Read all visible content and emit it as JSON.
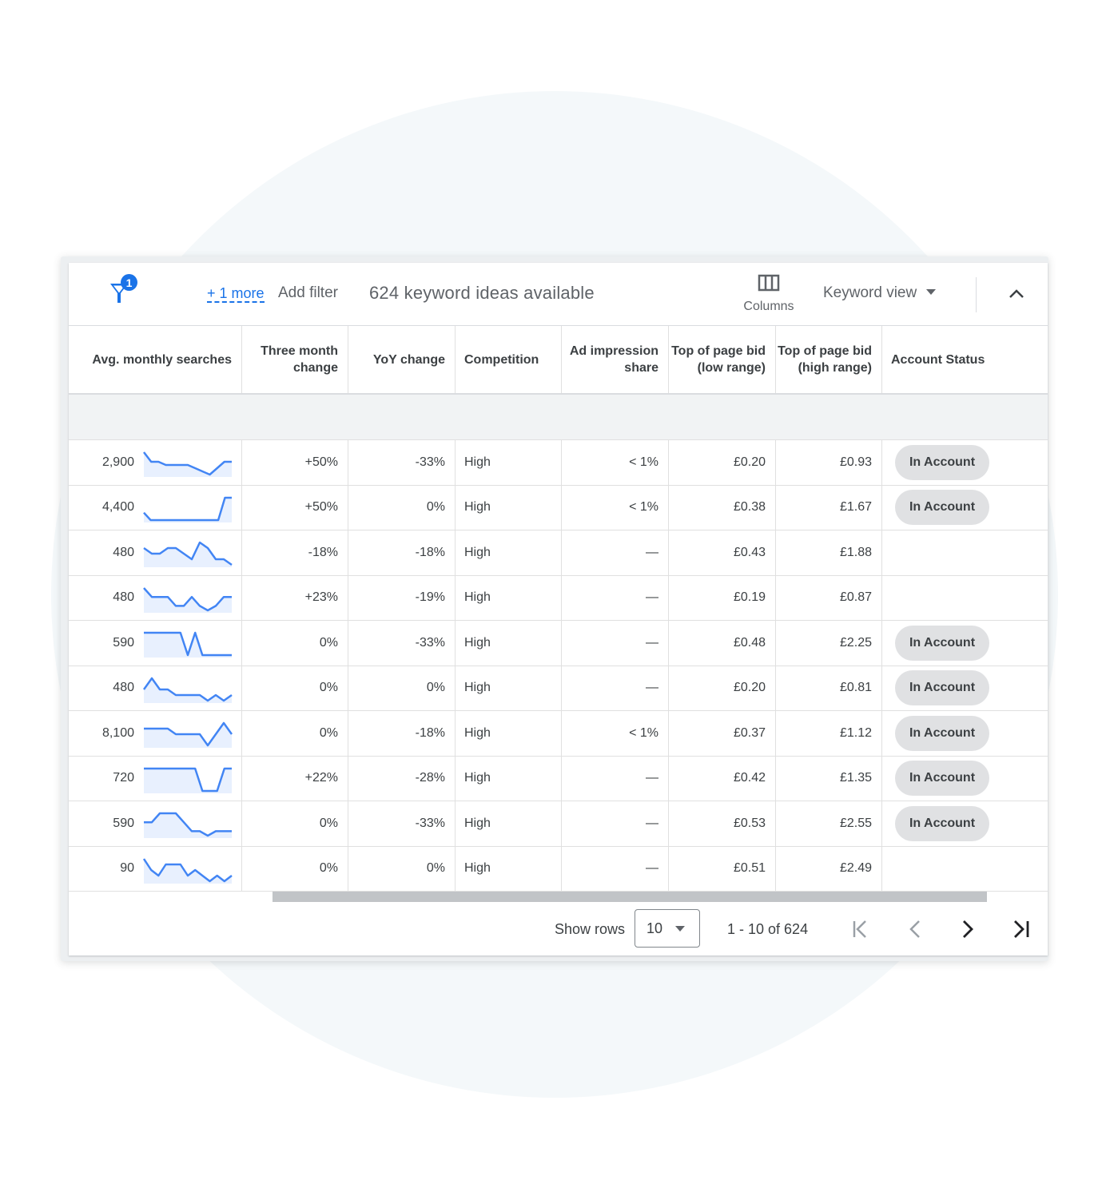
{
  "toolbar": {
    "filter_count": "1",
    "more_link": "+ 1 more",
    "add_filter": "Add filter",
    "ideas_count": "624 keyword ideas available",
    "columns_label": "Columns",
    "keyword_view": "Keyword view"
  },
  "table": {
    "headers": [
      "Avg. monthly searches",
      "Three month change",
      "YoY change",
      "Competition",
      "Ad impression share",
      "Top of page bid (low range)",
      "Top of page bid (high range)",
      "Account Status"
    ],
    "rows": [
      {
        "searches": "2,900",
        "three_month": "+50%",
        "yoy": "-33%",
        "competition": "High",
        "impression": "< 1%",
        "bid_low": "£0.20",
        "bid_high": "£0.93",
        "status": "In Account",
        "trend": [
          8,
          5,
          5,
          4,
          4,
          4,
          4,
          3,
          2,
          1,
          3,
          5,
          5
        ]
      },
      {
        "searches": "4,400",
        "three_month": "+50%",
        "yoy": "0%",
        "competition": "High",
        "impression": "< 1%",
        "bid_low": "£0.38",
        "bid_high": "£1.67",
        "status": "In Account",
        "trend": [
          2,
          1,
          1,
          1,
          1,
          1,
          1,
          1,
          1,
          1,
          1,
          1,
          4,
          4
        ]
      },
      {
        "searches": "480",
        "three_month": "-18%",
        "yoy": "-18%",
        "competition": "High",
        "impression": "—",
        "bid_low": "£0.43",
        "bid_high": "£1.88",
        "status": "",
        "trend": [
          4,
          3,
          3,
          4,
          4,
          3,
          2,
          5,
          4,
          2,
          2,
          1
        ]
      },
      {
        "searches": "480",
        "three_month": "+23%",
        "yoy": "-19%",
        "competition": "High",
        "impression": "—",
        "bid_low": "£0.19",
        "bid_high": "£0.87",
        "status": "",
        "trend": [
          6,
          4,
          4,
          4,
          2,
          2,
          4,
          2,
          1,
          2,
          4,
          4
        ]
      },
      {
        "searches": "590",
        "three_month": "0%",
        "yoy": "-33%",
        "competition": "High",
        "impression": "—",
        "bid_low": "£0.48",
        "bid_high": "£2.25",
        "status": "In Account",
        "trend": [
          5,
          5,
          5,
          5,
          5,
          5,
          1,
          5,
          1,
          1,
          1,
          1,
          1
        ]
      },
      {
        "searches": "480",
        "three_month": "0%",
        "yoy": "0%",
        "competition": "High",
        "impression": "—",
        "bid_low": "£0.20",
        "bid_high": "£0.81",
        "status": "In Account",
        "trend": [
          4,
          6,
          4,
          4,
          3,
          3,
          3,
          3,
          2,
          3,
          2,
          3
        ]
      },
      {
        "searches": "8,100",
        "three_month": "0%",
        "yoy": "-18%",
        "competition": "High",
        "impression": "< 1%",
        "bid_low": "£0.37",
        "bid_high": "£1.12",
        "status": "In Account",
        "trend": [
          5,
          5,
          5,
          5,
          4,
          4,
          4,
          4,
          2,
          4,
          6,
          4
        ]
      },
      {
        "searches": "720",
        "three_month": "+22%",
        "yoy": "-28%",
        "competition": "High",
        "impression": "—",
        "bid_low": "£0.42",
        "bid_high": "£1.35",
        "status": "In Account",
        "trend": [
          5,
          5,
          5,
          5,
          5,
          5,
          5,
          5,
          1,
          1,
          1,
          5,
          5
        ]
      },
      {
        "searches": "590",
        "three_month": "0%",
        "yoy": "-33%",
        "competition": "High",
        "impression": "—",
        "bid_low": "£0.53",
        "bid_high": "£2.55",
        "status": "In Account",
        "trend": [
          4,
          4,
          6,
          6,
          6,
          4,
          2,
          2,
          1,
          2,
          2,
          2
        ]
      },
      {
        "searches": "90",
        "three_month": "0%",
        "yoy": "0%",
        "competition": "High",
        "impression": "—",
        "bid_low": "£0.51",
        "bid_high": "£2.49",
        "status": "",
        "trend": [
          6,
          4,
          3,
          5,
          5,
          5,
          3,
          4,
          3,
          2,
          3,
          2,
          3
        ]
      }
    ]
  },
  "pagination": {
    "show_rows_label": "Show rows",
    "rows_value": "10",
    "range_text": "1 - 10 of 624"
  },
  "colors": {
    "accent": "#1a73e8",
    "sparkline": "#4285f4",
    "sparkline_fill": "#e8f0fe",
    "badge_bg": "#e0e1e3"
  }
}
